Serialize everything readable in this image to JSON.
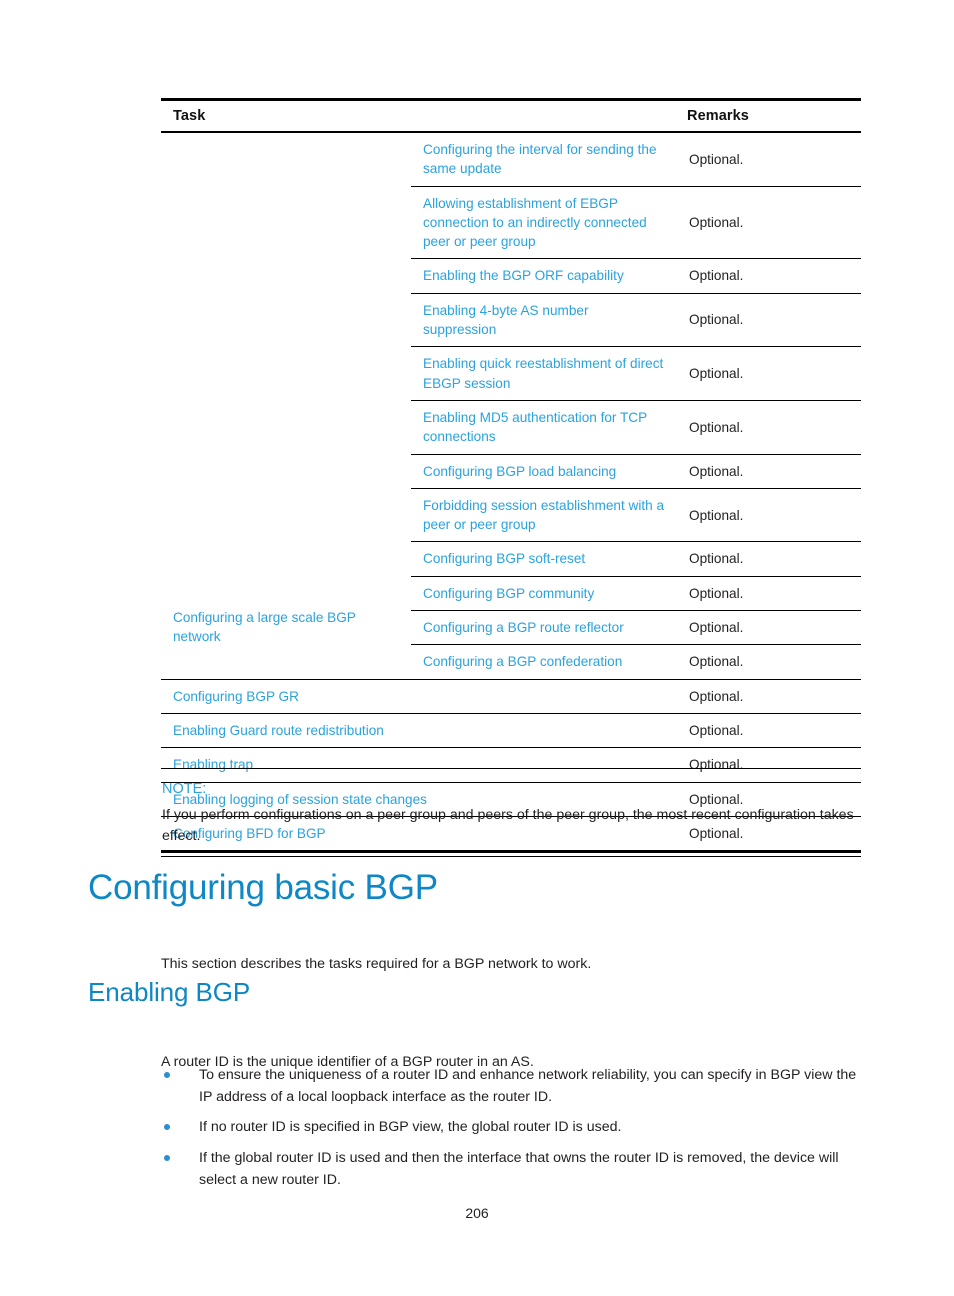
{
  "colors": {
    "link": "#2aa3dd",
    "heading": "#0e87c6",
    "text": "#231f20",
    "rule": "#000000",
    "bullet": "#2a8fce"
  },
  "table": {
    "headers": {
      "task": "Task",
      "remarks": "Remarks"
    },
    "rows": [
      {
        "group": "",
        "task": "Configuring the interval for sending the same update",
        "remarks": "Optional."
      },
      {
        "group": "",
        "task": "Allowing establishment of EBGP connection to an indirectly connected peer or peer group",
        "remarks": "Optional."
      },
      {
        "group": "",
        "task": "Enabling the BGP ORF capability",
        "remarks": "Optional."
      },
      {
        "group": "",
        "task": "Enabling 4-byte AS number suppression",
        "remarks": "Optional."
      },
      {
        "group": "",
        "task": "Enabling quick reestablishment of direct EBGP session",
        "remarks": "Optional."
      },
      {
        "group": "",
        "task": "Enabling MD5 authentication for TCP connections",
        "remarks": "Optional."
      },
      {
        "group": "",
        "task": "Configuring BGP load balancing",
        "remarks": "Optional."
      },
      {
        "group": "",
        "task": "Forbidding session establishment with a peer or peer group",
        "remarks": "Optional."
      },
      {
        "group": "",
        "task": "Configuring BGP soft-reset",
        "remarks": "Optional."
      },
      {
        "group": "Configuring a large scale BGP network",
        "task": "Configuring BGP community",
        "remarks": "Optional."
      },
      {
        "group": "",
        "task": "Configuring a BGP route reflector",
        "remarks": "Optional."
      },
      {
        "group": "",
        "task": "Configuring a BGP confederation",
        "remarks": "Optional."
      },
      {
        "group": "Configuring BGP GR",
        "task": "",
        "remarks": "Optional."
      },
      {
        "group": "Enabling Guard route redistribution",
        "task": "",
        "remarks": "Optional."
      },
      {
        "group": "Enabling trap",
        "task": "",
        "remarks": "Optional."
      },
      {
        "group": "Enabling logging of session state changes",
        "task": "",
        "remarks": "Optional."
      },
      {
        "group": "Configuring BFD for BGP",
        "task": "",
        "remarks": "Optional."
      }
    ]
  },
  "note": {
    "label": "NOTE:",
    "text": "If you perform configurations on a peer group and peers of the peer group, the most recent configuration takes effect."
  },
  "sections": {
    "h1": "Configuring basic BGP",
    "intro": "This section describes the tasks required for a BGP network to work.",
    "h2": "Enabling BGP",
    "lead": "A router ID is the unique identifier of a BGP router in an AS.",
    "bullets": [
      "To ensure the uniqueness of a router ID and enhance network reliability, you can specify in BGP view the IP address of a local loopback interface as the router ID.",
      "If no router ID is specified in BGP view, the global router ID is used.",
      "If the global router ID is used and then the interface that owns the router ID is removed, the device will select a new router ID."
    ]
  },
  "footer": {
    "page_number": "206"
  }
}
